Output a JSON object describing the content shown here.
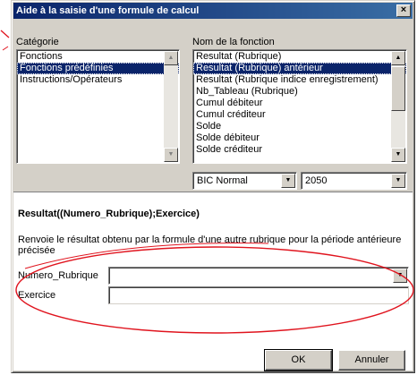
{
  "dialog": {
    "title": "Aide à la saisie d'une formule de calcul",
    "close_glyph": "×"
  },
  "category": {
    "label": "Catégorie",
    "items": [
      "Fonctions",
      "Fonctions prédéfinies",
      "Instructions/Opérateurs"
    ],
    "selected_index": 1
  },
  "function_list": {
    "label": "Nom de la fonction",
    "items": [
      "Resultat (Rubrique)",
      "Resultat (Rubrique) antérieur",
      "Resultat (Rubrique indice enregistrement)",
      "Nb_Tableau (Rubrique)",
      "Cumul débiteur",
      "Cumul créditeur",
      "Solde",
      "Solde débiteur",
      "Solde créditeur"
    ],
    "selected_index": 1
  },
  "filters": {
    "regime_value": "BIC Normal",
    "form_value": "2050"
  },
  "details": {
    "signature": "Resultat((Numero_Rubrique);Exercice)",
    "description": "Renvoie le résultat obtenu par la formule d'une autre rubrique pour la période antérieure précisée"
  },
  "params": {
    "numero_rubrique_label": "Numero_Rubrique",
    "numero_rubrique_value": "",
    "exercice_label": "Exercice",
    "exercice_value": ""
  },
  "buttons": {
    "ok_label": "OK",
    "cancel_label": "Annuler"
  },
  "colors": {
    "annotation": "#e0141e",
    "selection": "#0a246a",
    "title_start": "#0a246a",
    "title_end": "#3a6ea5"
  }
}
